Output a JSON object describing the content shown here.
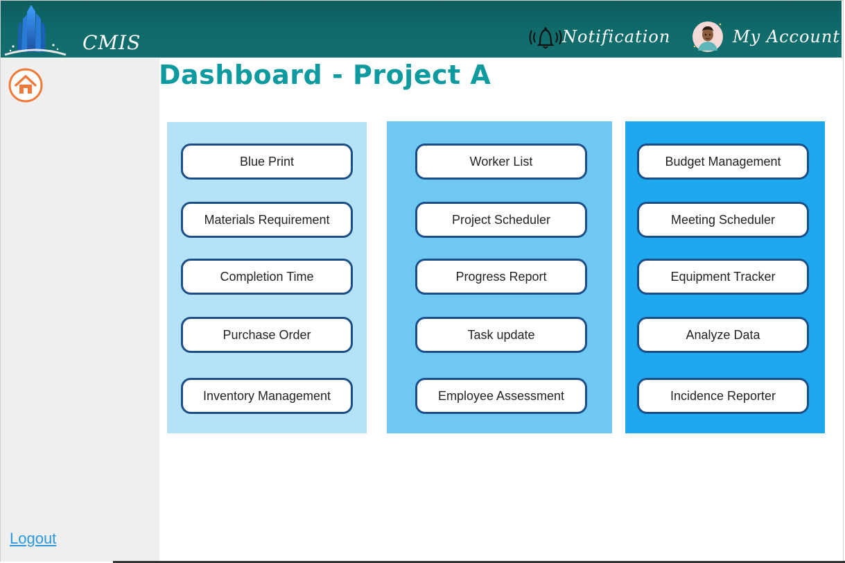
{
  "header": {
    "app_title": "CMIS",
    "notification_label": "Notification",
    "account_label": "My Account",
    "background_color": "#0f6566",
    "icons": [
      "building-logo-icon",
      "bell-icon",
      "avatar-icon"
    ]
  },
  "sidebar": {
    "home_icon": "home-icon",
    "logout_label": "Logout",
    "background_color": "#efefef"
  },
  "main": {
    "title": "Dashboard - Project A",
    "title_color": "#0e9a9e",
    "panels": [
      {
        "color": "#b6e2f8",
        "buttons": [
          "Blue Print",
          "Materials Requirement",
          "Completion Time",
          "Purchase Order",
          "Inventory Management"
        ]
      },
      {
        "color": "#6ec8f3",
        "buttons": [
          "Worker List",
          "Project Scheduler",
          "Progress Report",
          "Task update",
          "Employee Assessment"
        ]
      },
      {
        "color": "#1ea9ee",
        "buttons": [
          "Budget Management",
          "Meeting Scheduler",
          "Equipment Tracker",
          "Analyze Data",
          "Incidence Reporter"
        ]
      }
    ]
  }
}
